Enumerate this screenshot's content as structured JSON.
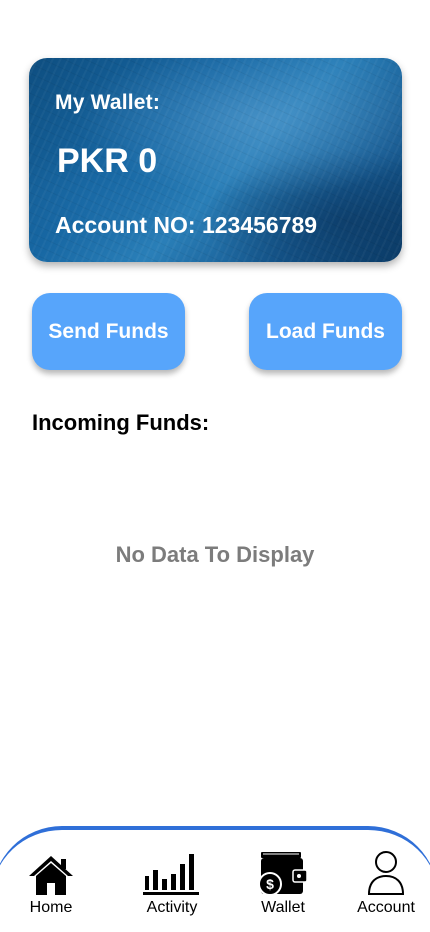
{
  "wallet": {
    "label": "My Wallet:",
    "balance": "PKR 0",
    "account": "Account NO: 123456789"
  },
  "actions": {
    "send_label": "Send Funds",
    "load_label": "Load Funds"
  },
  "incoming": {
    "title": "Incoming Funds:",
    "empty_text": "No Data To Display"
  },
  "nav": {
    "items": [
      {
        "label": "Home",
        "icon": "home-icon"
      },
      {
        "label": "Activity",
        "icon": "bar-chart-icon"
      },
      {
        "label": "Wallet",
        "icon": "wallet-icon"
      },
      {
        "label": "Account",
        "icon": "user-icon"
      }
    ]
  },
  "colors": {
    "button": "#57a5fb",
    "nav_border": "#2f6fd8",
    "card": "#1767a3",
    "muted_text": "#7c7c7c"
  }
}
